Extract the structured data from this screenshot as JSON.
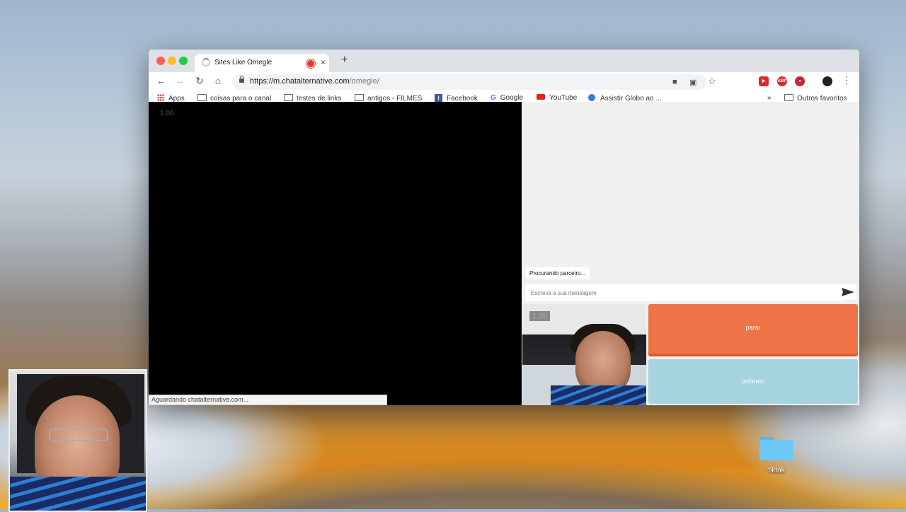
{
  "browser": {
    "tab_title": "Sites Like Omegle",
    "tab_close": "×",
    "new_tab": "+",
    "url_host": "https://m.chatalternative.com",
    "url_path": "/omegle/",
    "status_text": "Aguardando chatalternative.com..."
  },
  "bookmarks": {
    "items": [
      "Apps",
      "coisas para o canal",
      "testes de links",
      "antigos - FILMES",
      "Facebook",
      "Google",
      "YouTube",
      "Assistir Globo ao ..."
    ],
    "more": "»",
    "other": "Outros favoritos"
  },
  "chat": {
    "remote_scale": "1.00",
    "local_scale": "1.00",
    "searching": "Procurando parceiro...",
    "input_placeholder": "Escreva a sua mensagem",
    "stop_label": "parar",
    "next_label": "próximo"
  },
  "desktop": {
    "folder_label": "tiktak"
  },
  "colors": {
    "stop": "#ee7448",
    "next": "#a5d3de",
    "folder": "#6cc8f7"
  }
}
